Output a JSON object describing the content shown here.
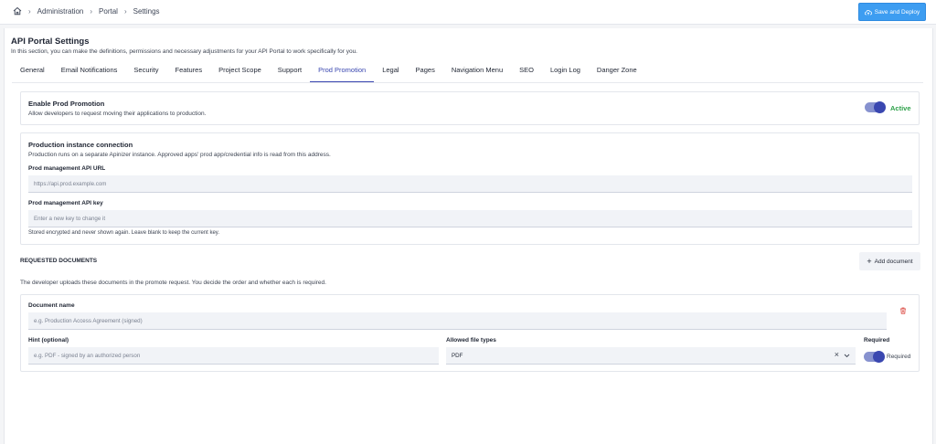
{
  "breadcrumb": {
    "items": [
      "Administration",
      "Portal",
      "Settings"
    ]
  },
  "header": {
    "deploy_label": "Save and Deploy"
  },
  "page": {
    "title": "API Portal Settings",
    "description": "In this section, you can make the definitions, permissions and necessary adjustments for your API Portal to work specifically for you."
  },
  "tabs": [
    "General",
    "Email Notifications",
    "Security",
    "Features",
    "Project Scope",
    "Support",
    "Prod Promotion",
    "Legal",
    "Pages",
    "Navigation Menu",
    "SEO",
    "Login Log",
    "Danger Zone"
  ],
  "active_tab": "Prod Promotion",
  "enable_card": {
    "title": "Enable Prod Promotion",
    "description": "Allow developers to request moving their applications to production.",
    "toggle_on": true,
    "status": "Active"
  },
  "connection_card": {
    "title": "Production instance connection",
    "description": "Production runs on a separate Apinizer instance. Approved apps' prod app/credential info is read from this address.",
    "url_label": "Prod management API URL",
    "url_value": "https://api.prod.example.com",
    "key_label": "Prod management API key",
    "key_placeholder": "Enter a new key to change it",
    "key_hint": "Stored encrypted and never shown again. Leave blank to keep the current key."
  },
  "documents": {
    "section_title": "REQUESTED DOCUMENTS",
    "add_label": "Add document",
    "description": "The developer uploads these documents in the promote request. You decide the order and whether each is required.",
    "doc": {
      "name_label": "Document name",
      "name_placeholder": "e.g. Production Access Agreement (signed)",
      "hint_label": "Hint (optional)",
      "hint_placeholder": "e.g. PDF - signed by an authorized person",
      "types_label": "Allowed file types",
      "types_value": "PDF",
      "required_label": "Required",
      "required_toggle_label": "Required",
      "required_on": true
    }
  },
  "colors": {
    "accent": "#3a47b0",
    "deploy": "#3d9df1",
    "active": "#2fa24b",
    "delete": "#d9413a"
  }
}
